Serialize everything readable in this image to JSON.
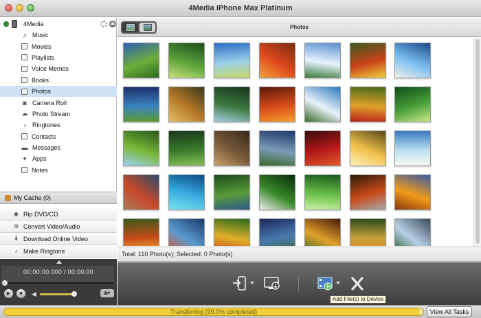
{
  "window": {
    "title": "4Media iPhone Max Platinum"
  },
  "sidebar": {
    "device": {
      "label": "4Media",
      "icon": "iphone-icon"
    },
    "items": [
      {
        "label": "Music",
        "icon": "music-note-icon"
      },
      {
        "label": "Movies",
        "icon": "film-icon"
      },
      {
        "label": "Playlists",
        "icon": "playlist-icon"
      },
      {
        "label": "Voice Memos",
        "icon": "voice-memo-icon"
      },
      {
        "label": "Books",
        "icon": "book-icon"
      },
      {
        "label": "Photos",
        "icon": "photo-icon",
        "selected": true
      },
      {
        "label": "Camera Roll",
        "icon": "camera-icon"
      },
      {
        "label": "Photo Stream",
        "icon": "photo-stream-icon"
      },
      {
        "label": "Ringtones",
        "icon": "bell-icon"
      },
      {
        "label": "Contacts",
        "icon": "contacts-icon"
      },
      {
        "label": "Messages",
        "icon": "message-icon"
      },
      {
        "label": "Apps",
        "icon": "apps-icon"
      },
      {
        "label": "Notes",
        "icon": "notes-icon"
      }
    ],
    "cache_label": "My Cache (0)",
    "tools": [
      {
        "label": "Rip DVD/CD",
        "icon": "disc-icon"
      },
      {
        "label": "Convert Video/Audio",
        "icon": "convert-icon"
      },
      {
        "label": "Download Online Video",
        "icon": "download-icon"
      },
      {
        "label": "Make Ringtone",
        "icon": "ringtone-icon"
      }
    ]
  },
  "player": {
    "time": "00:00:00.000 / 00:00:00"
  },
  "main": {
    "panel_title": "Photos",
    "status_text": "Total: 110 Photo(s); Selected: 0 Photo(s)",
    "tooltip": "Add File(s) to Device"
  },
  "transfer": {
    "text": "Transferring (99.0% completed)",
    "progress": 0.99,
    "view_all_label": "View All Tasks"
  },
  "colors": {
    "selected_row": "#cfe2f7",
    "progress": "#f3cf3a"
  }
}
